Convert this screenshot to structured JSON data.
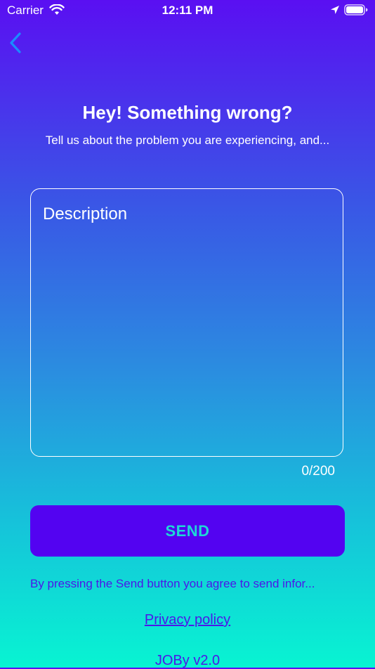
{
  "status_bar": {
    "carrier": "Carrier",
    "time": "12:11 PM"
  },
  "header": {
    "title": "Hey! Something wrong?",
    "subtitle": "Tell us about the problem you are experiencing, and..."
  },
  "form": {
    "description_placeholder": "Description",
    "description_value": "",
    "counter": "0/200",
    "send_label": "SEND"
  },
  "footer": {
    "disclaimer": "By pressing the Send button you agree to send infor...",
    "privacy_link": "Privacy policy",
    "version": "JOBy v2.0"
  },
  "colors": {
    "button_bg": "#5303f1",
    "button_text": "#1dd8d6",
    "link": "#4b18e8",
    "back_arrow": "#1a8cff"
  },
  "icons": {
    "back": "chevron-left-icon",
    "wifi": "wifi-icon",
    "location": "location-arrow-icon",
    "battery": "battery-icon"
  }
}
